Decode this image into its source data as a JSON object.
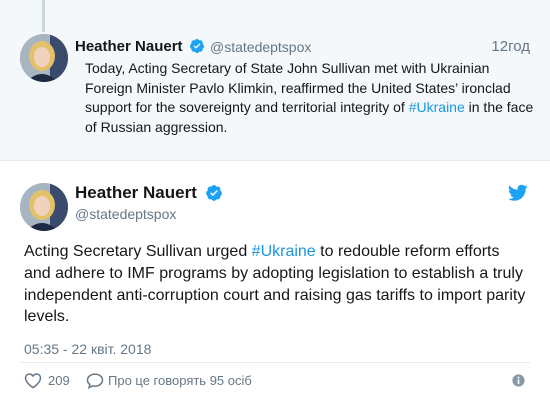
{
  "parent_tweet": {
    "name": "Heather Nauert",
    "handle": "@statedeptspox",
    "time": "12год",
    "text_parts": [
      "Today, Acting Secretary of State John Sullivan met with Ukrainian Foreign Minister Pavlo Klimkin, reaffirmed the United States’ ironclad support for the sovereignty and territorial integrity of ",
      "#Ukraine",
      " in the face of Russian aggression."
    ]
  },
  "main_tweet": {
    "name": "Heather Nauert",
    "handle": "@statedeptspox",
    "text_parts": [
      "Acting Secretary Sullivan urged ",
      "#Ukraine",
      " to redouble reform efforts and adhere to IMF programs by adopting legislation to establish a truly independent anti-corruption court and raising gas tariffs to import parity levels."
    ],
    "date": "05:35 - 22 квіт. 2018",
    "likes": "209",
    "talk_text": "Про це говорять 95 осіб"
  },
  "icons": {
    "verified": "verified-badge-icon",
    "twitter": "twitter-bird-icon",
    "like": "heart-icon",
    "reply": "speech-bubble-icon",
    "info": "info-icon"
  },
  "colors": {
    "accent": "#1b95e0",
    "verified": "#1da1f2",
    "secondary_text": "#657786",
    "parent_background": "#f5f8fa"
  }
}
